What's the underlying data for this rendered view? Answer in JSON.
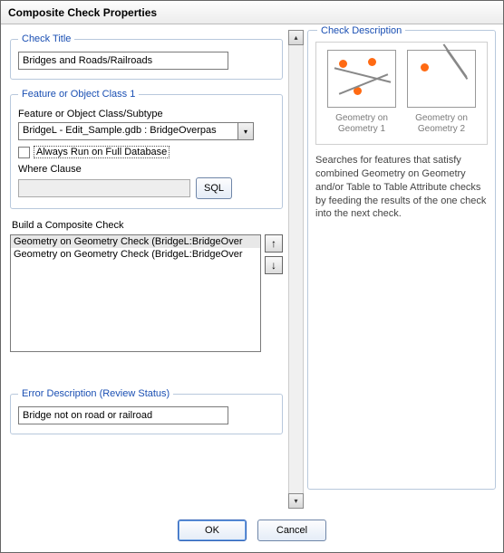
{
  "window": {
    "title": "Composite Check Properties"
  },
  "checkTitle": {
    "legend": "Check Title",
    "value": "Bridges and Roads/Railroads"
  },
  "featureClass": {
    "legend": "Feature or Object Class 1",
    "label": "Feature or Object Class/Subtype",
    "combo": "BridgeL -  Edit_Sample.gdb : BridgeOverpas",
    "alwaysRun": "Always Run on Full Database",
    "whereLabel": "Where Clause",
    "whereValue": "",
    "sql": "SQL"
  },
  "build": {
    "label": "Build a Composite Check",
    "items": [
      "Geometry on Geometry Check (BridgeL:BridgeOver",
      "Geometry on Geometry Check (BridgeL:BridgeOver"
    ]
  },
  "errorDesc": {
    "legend": "Error Description (Review Status)",
    "value": "Bridge not on road or railroad"
  },
  "description": {
    "legend": "Check Description",
    "thumb1": "Geometry on Geometry 1",
    "thumb2": "Geometry on Geometry 2",
    "text": "Searches for features that satisfy combined Geometry on Geometry and/or Table to Table Attribute checks by feeding the results of the one check into the next check."
  },
  "buttons": {
    "ok": "OK",
    "cancel": "Cancel"
  }
}
